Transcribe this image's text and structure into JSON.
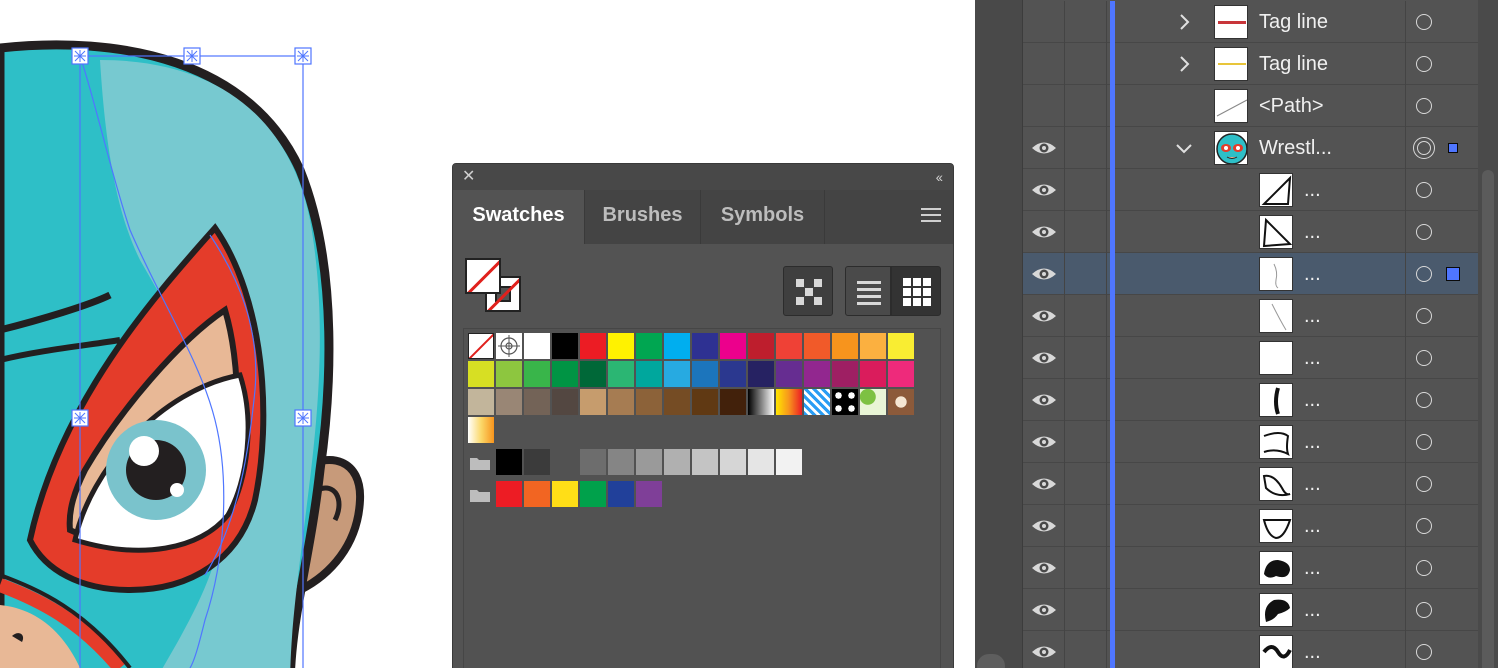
{
  "swatches_panel": {
    "close_icon": "close-icon",
    "collapse_icon": "double-chevron-left-icon",
    "tabs": [
      {
        "label": "Swatches",
        "active": true
      },
      {
        "label": "Brushes",
        "active": false
      },
      {
        "label": "Symbols",
        "active": false
      }
    ],
    "rows": [
      [
        "none",
        "registration",
        "#ffffff",
        "#000000",
        "#ec1c24",
        "#fff200",
        "#00a651",
        "#00aeef",
        "#2e3192",
        "#ec008c",
        "#be1e2d",
        "#ef4136",
        "#f15a29",
        "#f7941d",
        "#fbb040",
        "#f9ed32"
      ],
      [
        "#d7df23",
        "#8dc63f",
        "#39b54a",
        "#009444",
        "#006838",
        "#2bb673",
        "#00a79d",
        "#27aae1",
        "#1c75bc",
        "#2b388f",
        "#262262",
        "#662d91",
        "#92278f",
        "#9e1f63",
        "#da1c5c",
        "#ee2a7b"
      ],
      [
        "#c2b59b",
        "#998675",
        "#736357",
        "#534741",
        "#c69c6d",
        "#a67c52",
        "#8c6239",
        "#754c24",
        "#603913",
        "#42210b",
        "gradient-bw",
        "gradient-orange",
        "pattern-blue",
        "pattern-dots",
        "pattern-leaves",
        "pattern-paisley"
      ],
      [
        "gradient-yellow"
      ]
    ],
    "group_grays": [
      "#000000",
      "#3b3b3b",
      "#525252",
      "#6d6d6d",
      "#858585",
      "#9a9a9a",
      "#b0b0b0",
      "#c4c4c4",
      "#d6d6d6",
      "#e5e5e5",
      "#f2f2f2"
    ],
    "group_brights": [
      "#ed1c24",
      "#f26522",
      "#ffde17",
      "#00a14b",
      "#21409a",
      "#7f3f98"
    ]
  },
  "layers_panel": {
    "rows": [
      {
        "name": "Tag line",
        "visible": false,
        "expand": "collapsed",
        "thumb": "tagline-red",
        "indent": 0
      },
      {
        "name": "Tag line",
        "visible": false,
        "expand": "collapsed",
        "thumb": "tagline-yellow",
        "indent": 0
      },
      {
        "name": "<Path>",
        "visible": false,
        "expand": "none",
        "thumb": "path-line",
        "indent": 0
      },
      {
        "name": "Wrestl...",
        "visible": true,
        "expand": "expanded",
        "thumb": "wrestler-face",
        "indent": 0,
        "targeted": true,
        "has_selection": true
      },
      {
        "name": "...",
        "visible": true,
        "expand": "none",
        "thumb": "shape-1",
        "indent": 1
      },
      {
        "name": "...",
        "visible": true,
        "expand": "none",
        "thumb": "shape-2",
        "indent": 1
      },
      {
        "name": "...",
        "visible": true,
        "expand": "none",
        "thumb": "shape-3",
        "indent": 1,
        "selected": true
      },
      {
        "name": "...",
        "visible": true,
        "expand": "none",
        "thumb": "shape-4",
        "indent": 1
      },
      {
        "name": "...",
        "visible": true,
        "expand": "none",
        "thumb": "blank",
        "indent": 1
      },
      {
        "name": "...",
        "visible": true,
        "expand": "none",
        "thumb": "shape-6",
        "indent": 1
      },
      {
        "name": "...",
        "visible": true,
        "expand": "none",
        "thumb": "shape-7",
        "indent": 1
      },
      {
        "name": "...",
        "visible": true,
        "expand": "none",
        "thumb": "shape-8",
        "indent": 1
      },
      {
        "name": "...",
        "visible": true,
        "expand": "none",
        "thumb": "shape-9",
        "indent": 1
      },
      {
        "name": "...",
        "visible": true,
        "expand": "none",
        "thumb": "shape-10",
        "indent": 1
      },
      {
        "name": "...",
        "visible": true,
        "expand": "none",
        "thumb": "shape-11",
        "indent": 1
      },
      {
        "name": "...",
        "visible": true,
        "expand": "none",
        "thumb": "shape-12",
        "indent": 1
      }
    ]
  }
}
